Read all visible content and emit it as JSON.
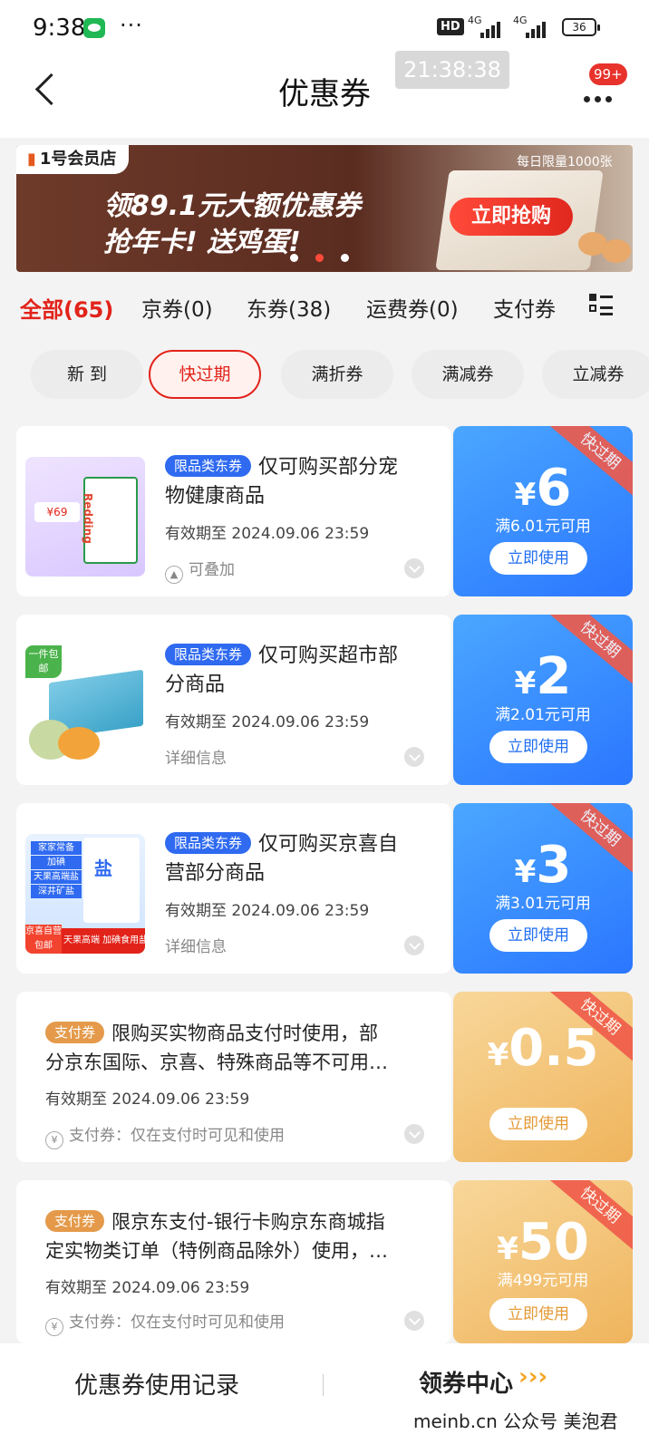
{
  "status_bar": {
    "time": "9:38",
    "more": "···",
    "hd": "HD",
    "network_1": "4G",
    "network_2": "4G",
    "battery": "36"
  },
  "header": {
    "title": "优惠券",
    "overlay_clock": "21:38:38",
    "badge": "99+"
  },
  "banner": {
    "store": "1号会员店",
    "limit": "每日限量1000张",
    "line1": "领89.1元大额优惠券",
    "line2": "抢年卡! 送鸡蛋!",
    "cta": "立即抢购"
  },
  "tabs": [
    {
      "label": "全部(65)"
    },
    {
      "label": "京券(0)"
    },
    {
      "label": "东券(38)"
    },
    {
      "label": "运费券(0)"
    },
    {
      "label": "支付券"
    }
  ],
  "chips": [
    {
      "label": "新 到"
    },
    {
      "label": "快过期"
    },
    {
      "label": "满折券"
    },
    {
      "label": "满减券"
    },
    {
      "label": "立减券"
    }
  ],
  "coupons": [
    {
      "tag": "限品类东券",
      "desc_line1": "仅可购买部分宠",
      "desc_line2": "物健康商品",
      "expire": "有效期至 2024.09.06 23:59",
      "foot": "可叠加",
      "ribbon": "快过期",
      "yen": "¥",
      "amount": "6",
      "condition": "满6.01元可用",
      "button": "立即使用",
      "thumb_label": "Redding",
      "thumb_price": "¥69"
    },
    {
      "tag": "限品类东券",
      "desc_line1": "仅可购买超市部",
      "desc_line2": "分商品",
      "expire": "有效期至 2024.09.06 23:59",
      "foot": "详细信息",
      "ribbon": "快过期",
      "yen": "¥",
      "amount": "2",
      "condition": "满2.01元可用",
      "button": "立即使用",
      "thumb_label": "一件包邮"
    },
    {
      "tag": "限品类东券",
      "desc_line1": "仅可购买京喜自",
      "desc_line2": "营部分商品",
      "expire": "有效期至 2024.09.06 23:59",
      "foot": "详细信息",
      "ribbon": "快过期",
      "yen": "¥",
      "amount": "3",
      "condition": "满3.01元可用",
      "button": "立即使用",
      "thumb_label": "盐",
      "thumb_lines": [
        "家家常备",
        "加碘",
        "天果高端盐",
        "深井矿盐"
      ],
      "thumb_bottom": "天果高端 加碘食用盐",
      "thumb_badge": "京喜自营 包邮"
    },
    {
      "tag": "支付券",
      "desc_line1": "限购买实物商品支付时使用，部",
      "desc_line2": "分京东国际、京喜、特殊商品等不可用…",
      "expire": "有效期至 2024.09.06 23:59",
      "foot": "支付券：仅在支付时可见和使用",
      "ribbon": "快过期",
      "yen": "¥",
      "amount": "0.5",
      "condition": "",
      "button": "立即使用"
    },
    {
      "tag": "支付券",
      "desc_line1": "限京东支付-银行卡购京东商城指",
      "desc_line2": "定实物类订单（特例商品除外）使用，…",
      "expire": "有效期至 2024.09.06 23:59",
      "foot": "支付券：仅在支付时可见和使用",
      "ribbon": "快过期",
      "yen": "¥",
      "amount": "50",
      "condition": "满499元可用",
      "button": "立即使用"
    }
  ],
  "bottom": {
    "records": "优惠券使用记录",
    "center": "领券中心",
    "arrows": "›››",
    "watermark": "meinb.cn  公众号 美泡君"
  },
  "colors": {
    "accent": "#e2231a",
    "coupon_blue": "#2b76ff",
    "coupon_gold": "#efb45c"
  }
}
